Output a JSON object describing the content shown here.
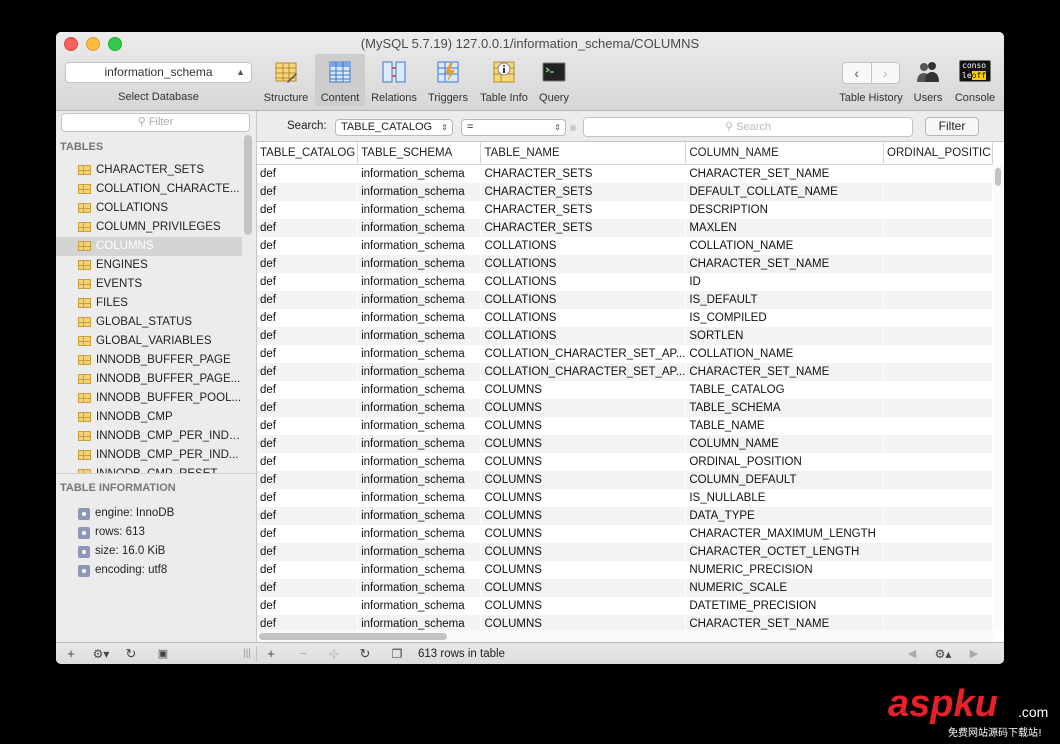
{
  "window": {
    "title": "(MySQL 5.7.19) 127.0.0.1/information_schema/COLUMNS"
  },
  "toolbar": {
    "database_value": "information_schema",
    "database_label": "Select Database",
    "items": [
      {
        "label": "Structure",
        "icon": "structure-icon"
      },
      {
        "label": "Content",
        "icon": "content-icon",
        "active": true
      },
      {
        "label": "Relations",
        "icon": "relations-icon"
      },
      {
        "label": "Triggers",
        "icon": "triggers-icon"
      },
      {
        "label": "Table Info",
        "icon": "table-info-icon"
      },
      {
        "label": "Query",
        "icon": "query-icon"
      }
    ],
    "history_label": "Table History",
    "users_label": "Users",
    "console_label": "Console",
    "console_icon_text_1": "conso",
    "console_icon_text_2": "le",
    "console_icon_text_3": "off",
    "back_glyph": "‹",
    "forward_glyph": "›"
  },
  "sidebar": {
    "filter_placeholder": "Filter",
    "tables_heading": "TABLES",
    "tables": [
      "CHARACTER_SETS",
      "COLLATION_CHARACTE...",
      "COLLATIONS",
      "COLUMN_PRIVILEGES",
      "COLUMNS",
      "ENGINES",
      "EVENTS",
      "FILES",
      "GLOBAL_STATUS",
      "GLOBAL_VARIABLES",
      "INNODB_BUFFER_PAGE",
      "INNODB_BUFFER_PAGE...",
      "INNODB_BUFFER_POOL...",
      "INNODB_CMP",
      "INNODB_CMP_PER_INDEX",
      "INNODB_CMP_PER_IND...",
      "INNODB_CMP_RESET"
    ],
    "selected_table": "COLUMNS",
    "info_heading": "TABLE INFORMATION",
    "info": [
      "engine: InnoDB",
      "rows: 613",
      "size: 16.0 KiB",
      "encoding: utf8"
    ]
  },
  "search": {
    "label": "Search:",
    "field_value": "TABLE_CATALOG",
    "operator_value": "=",
    "placeholder": "Search",
    "filter_button": "Filter"
  },
  "grid": {
    "columns": [
      "TABLE_CATALOG",
      "TABLE_SCHEMA",
      "TABLE_NAME",
      "COLUMN_NAME",
      "ORDINAL_POSITIC"
    ],
    "rows": [
      [
        "def",
        "information_schema",
        "CHARACTER_SETS",
        "CHARACTER_SET_NAME",
        ""
      ],
      [
        "def",
        "information_schema",
        "CHARACTER_SETS",
        "DEFAULT_COLLATE_NAME",
        ""
      ],
      [
        "def",
        "information_schema",
        "CHARACTER_SETS",
        "DESCRIPTION",
        ""
      ],
      [
        "def",
        "information_schema",
        "CHARACTER_SETS",
        "MAXLEN",
        ""
      ],
      [
        "def",
        "information_schema",
        "COLLATIONS",
        "COLLATION_NAME",
        ""
      ],
      [
        "def",
        "information_schema",
        "COLLATIONS",
        "CHARACTER_SET_NAME",
        ""
      ],
      [
        "def",
        "information_schema",
        "COLLATIONS",
        "ID",
        ""
      ],
      [
        "def",
        "information_schema",
        "COLLATIONS",
        "IS_DEFAULT",
        ""
      ],
      [
        "def",
        "information_schema",
        "COLLATIONS",
        "IS_COMPILED",
        ""
      ],
      [
        "def",
        "information_schema",
        "COLLATIONS",
        "SORTLEN",
        ""
      ],
      [
        "def",
        "information_schema",
        "COLLATION_CHARACTER_SET_AP...",
        "COLLATION_NAME",
        ""
      ],
      [
        "def",
        "information_schema",
        "COLLATION_CHARACTER_SET_AP...",
        "CHARACTER_SET_NAME",
        ""
      ],
      [
        "def",
        "information_schema",
        "COLUMNS",
        "TABLE_CATALOG",
        ""
      ],
      [
        "def",
        "information_schema",
        "COLUMNS",
        "TABLE_SCHEMA",
        ""
      ],
      [
        "def",
        "information_schema",
        "COLUMNS",
        "TABLE_NAME",
        ""
      ],
      [
        "def",
        "information_schema",
        "COLUMNS",
        "COLUMN_NAME",
        ""
      ],
      [
        "def",
        "information_schema",
        "COLUMNS",
        "ORDINAL_POSITION",
        ""
      ],
      [
        "def",
        "information_schema",
        "COLUMNS",
        "COLUMN_DEFAULT",
        ""
      ],
      [
        "def",
        "information_schema",
        "COLUMNS",
        "IS_NULLABLE",
        ""
      ],
      [
        "def",
        "information_schema",
        "COLUMNS",
        "DATA_TYPE",
        ""
      ],
      [
        "def",
        "information_schema",
        "COLUMNS",
        "CHARACTER_MAXIMUM_LENGTH",
        ""
      ],
      [
        "def",
        "information_schema",
        "COLUMNS",
        "CHARACTER_OCTET_LENGTH",
        ""
      ],
      [
        "def",
        "information_schema",
        "COLUMNS",
        "NUMERIC_PRECISION",
        ""
      ],
      [
        "def",
        "information_schema",
        "COLUMNS",
        "NUMERIC_SCALE",
        ""
      ],
      [
        "def",
        "information_schema",
        "COLUMNS",
        "DATETIME_PRECISION",
        ""
      ],
      [
        "def",
        "information_schema",
        "COLUMNS",
        "CHARACTER_SET_NAME",
        ""
      ]
    ]
  },
  "bottombar": {
    "row_count": "613 rows in table"
  },
  "watermark": {
    "text": "aspku",
    "suffix": ".com",
    "subtitle": "免费网站源码下载站!"
  },
  "colors": {
    "selection": "#d4d4d4",
    "watermark_red": "#e8202a"
  }
}
